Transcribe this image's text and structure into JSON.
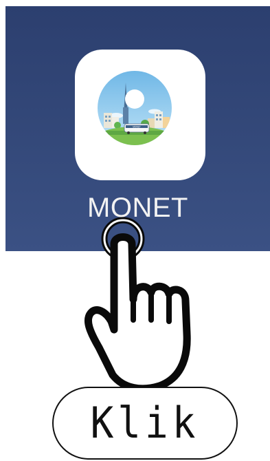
{
  "home_screen": {
    "background_color": "#2c3f6f",
    "app": {
      "name": "MONET",
      "icon": "city-bus-globe-icon",
      "bus_sign": "MONET"
    }
  },
  "gesture": {
    "icon": "tap-hand-icon"
  },
  "action_button": {
    "label": "Klik"
  }
}
